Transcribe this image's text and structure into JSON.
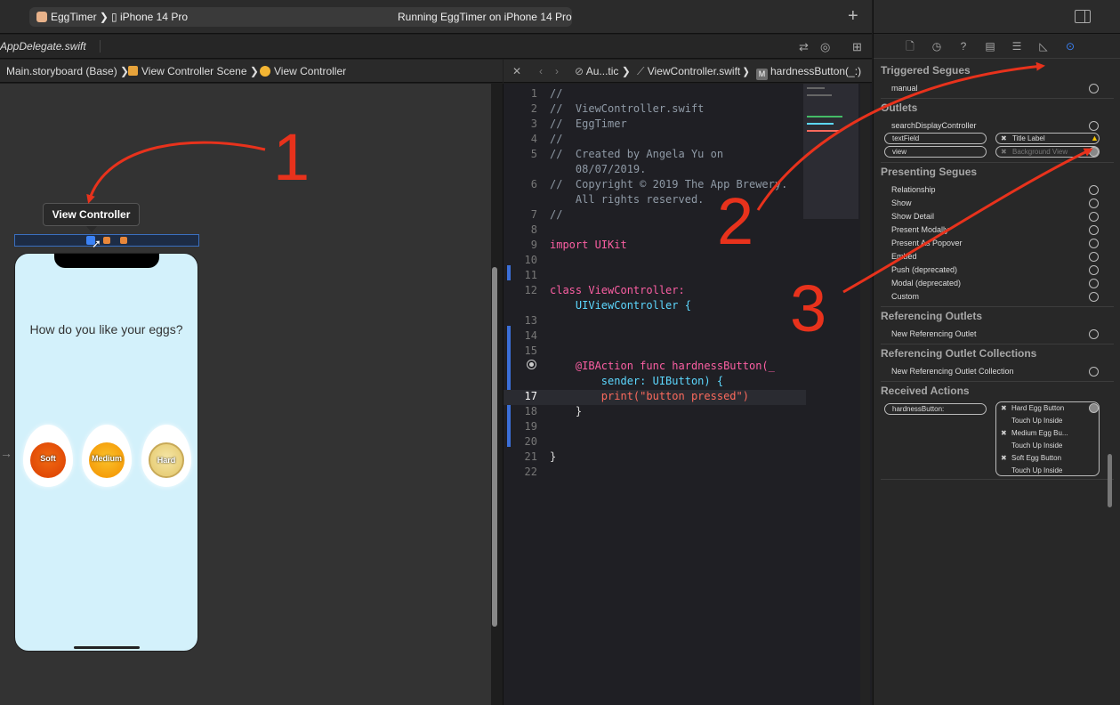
{
  "toolbar": {
    "app": "EggTimer",
    "device": "iPhone 14 Pro",
    "status": "Running EggTimer on iPhone 14 Pro",
    "add": "+"
  },
  "tab": {
    "file": "AppDelegate.swift"
  },
  "breadcrumb_left": [
    "Main.storyboard (Base)",
    "View Controller Scene",
    "View Controller"
  ],
  "breadcrumb_right": [
    "Au...tic",
    "ViewController.swift",
    "hardnessButton(_:)"
  ],
  "canvas": {
    "vc_label": "View Controller",
    "question": "How do you like your eggs?",
    "eggs": [
      "Soft",
      "Medium",
      "Hard"
    ]
  },
  "code": [
    {
      "n": "1",
      "t": "//"
    },
    {
      "n": "2",
      "t": "//  ViewController.swift"
    },
    {
      "n": "3",
      "t": "//  EggTimer"
    },
    {
      "n": "4",
      "t": "//"
    },
    {
      "n": "5",
      "t": "//  Created by Angela Yu on"
    },
    {
      "n": "",
      "t": "    08/07/2019."
    },
    {
      "n": "6",
      "t": "//  Copyright © 2019 The App Brewery."
    },
    {
      "n": "",
      "t": "    All rights reserved."
    },
    {
      "n": "7",
      "t": "//"
    },
    {
      "n": "8",
      "t": ""
    },
    {
      "n": "9",
      "t": "import UIKit"
    },
    {
      "n": "10",
      "t": ""
    },
    {
      "n": "11",
      "t": ""
    },
    {
      "n": "12",
      "t": "class ViewController:"
    },
    {
      "n": "",
      "t": "    UIViewController {"
    },
    {
      "n": "13",
      "t": ""
    },
    {
      "n": "14",
      "t": ""
    },
    {
      "n": "15",
      "t": ""
    },
    {
      "n": "",
      "t": "    @IBAction func hardnessButton(_"
    },
    {
      "n": "",
      "t": "        sender: UIButton) {"
    },
    {
      "n": "17",
      "t": "        print(\"button pressed\")"
    },
    {
      "n": "18",
      "t": "    }"
    },
    {
      "n": "19",
      "t": ""
    },
    {
      "n": "20",
      "t": ""
    },
    {
      "n": "21",
      "t": "}"
    },
    {
      "n": "22",
      "t": ""
    }
  ],
  "inspector": {
    "sections": {
      "triggered": "Triggered Segues",
      "outlets": "Outlets",
      "presenting": "Presenting Segues",
      "ref_outlets": "Referencing Outlets",
      "ref_collections": "Referencing Outlet Collections",
      "received": "Received Actions"
    },
    "manual": "manual",
    "outlet_search": "searchDisplayController",
    "outlet_textfield": "textField",
    "outlet_textfield_conn": "Title Label",
    "outlet_view": "view",
    "outlet_view_conn": "Background View",
    "segues": [
      "Relationship",
      "Show",
      "Show Detail",
      "Present Modally",
      "Present As Popover",
      "Embed",
      "Push (deprecated)",
      "Modal (deprecated)",
      "Custom"
    ],
    "new_ref_outlet": "New Referencing Outlet",
    "new_ref_collection": "New Referencing Outlet Collection",
    "action": "hardnessButton:",
    "action_conns": [
      "Hard Egg Button",
      "Touch Up Inside",
      "Medium Egg Bu...",
      "Touch Up Inside",
      "Soft Egg Button",
      "Touch Up Inside"
    ]
  },
  "annotations": [
    "1",
    "2",
    "3"
  ],
  "colors": {
    "annotation": "#e8321c",
    "accent": "#3b82f6"
  }
}
